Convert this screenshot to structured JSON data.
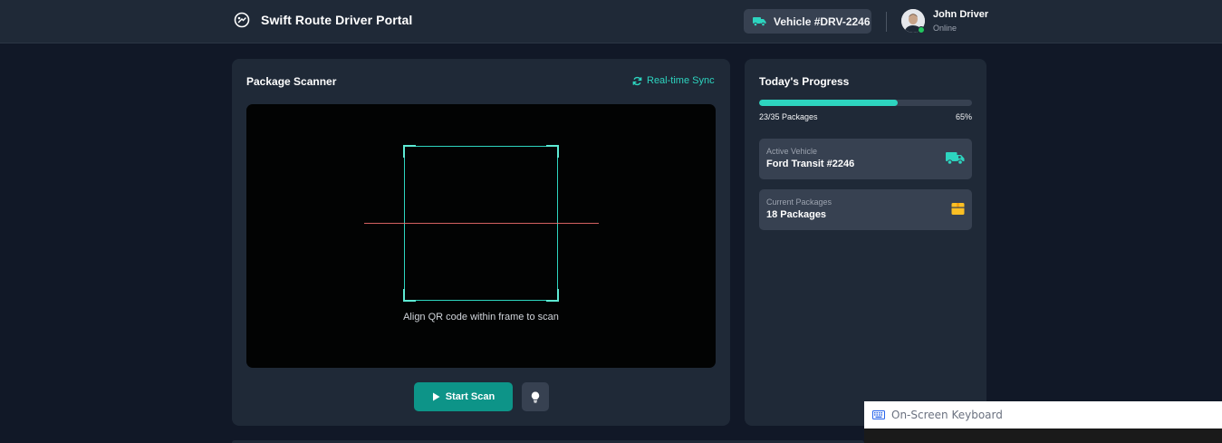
{
  "header": {
    "title": "Swift Route Driver Portal",
    "logo_icon": "route-logo-icon",
    "vehicle_chip": "Vehicle #DRV-2246",
    "user": {
      "name": "John Driver",
      "status": "Online"
    }
  },
  "scanner": {
    "title": "Package Scanner",
    "sync_label": "Real-time Sync",
    "hint": "Align QR code within frame to scan",
    "start_button": "Start Scan"
  },
  "progress": {
    "title": "Today's Progress",
    "packages_text": "23/35 Packages",
    "percent_text": "65%",
    "percent_value": 65,
    "cards": [
      {
        "label": "Active Vehicle",
        "value": "Ford Transit #2246",
        "icon": "truck-icon"
      },
      {
        "label": "Current Packages",
        "value": "18 Packages",
        "icon": "package-box-icon"
      }
    ]
  },
  "osk": {
    "title": "On-Screen Keyboard"
  },
  "colors": {
    "accent": "#2dd4bf",
    "button": "#0d9488",
    "scanline": "#f87171",
    "package_icon": "#fbbf24",
    "online": "#22c55e"
  }
}
